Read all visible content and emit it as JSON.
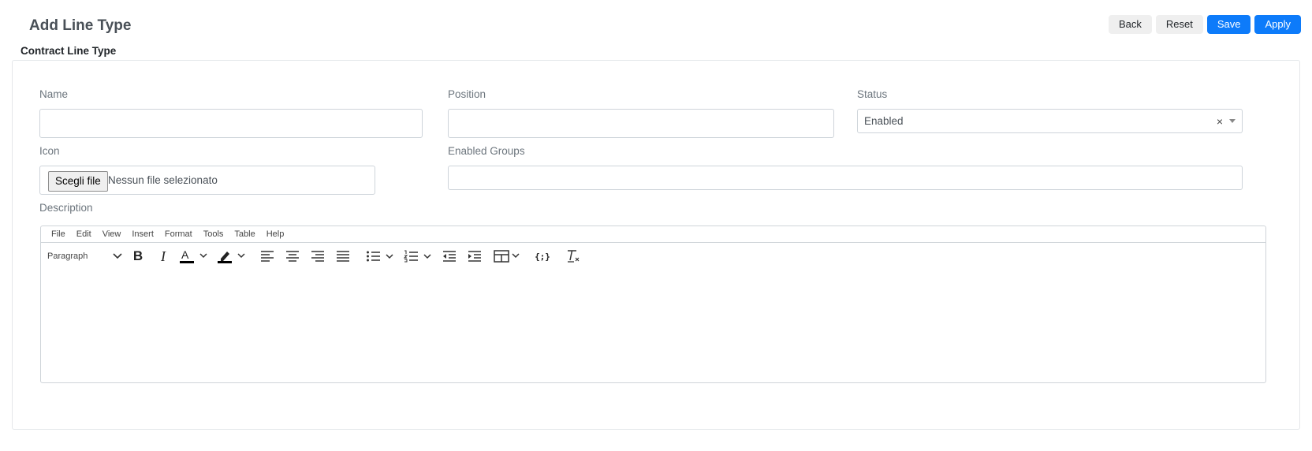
{
  "page": {
    "title": "Add Line Type"
  },
  "actions": {
    "back": "Back",
    "reset": "Reset",
    "save": "Save",
    "apply": "Apply"
  },
  "section": {
    "title": "Contract Line Type"
  },
  "form": {
    "name": {
      "label": "Name",
      "value": ""
    },
    "position": {
      "label": "Position",
      "value": ""
    },
    "status": {
      "label": "Status",
      "value": "Enabled",
      "clear": "×"
    },
    "icon": {
      "label": "Icon",
      "button": "Scegli file",
      "text": "Nessun file selezionato"
    },
    "enabled_groups": {
      "label": "Enabled Groups",
      "value": ""
    },
    "description": {
      "label": "Description"
    }
  },
  "editor": {
    "menu": [
      "File",
      "Edit",
      "View",
      "Insert",
      "Format",
      "Tools",
      "Table",
      "Help"
    ],
    "block_format": "Paragraph",
    "icons": [
      "chevron-down-icon",
      "bold-icon",
      "italic-icon",
      "text-color-icon",
      "highlight-icon",
      "align-left-icon",
      "align-center-icon",
      "align-right-icon",
      "align-justify-icon",
      "bullet-list-icon",
      "numbered-list-icon",
      "outdent-icon",
      "indent-icon",
      "table-icon",
      "code-variable-icon",
      "clear-formatting-icon"
    ]
  },
  "colors": {
    "primary": "#0d7bfa",
    "light_button": "#efefef",
    "border": "#ced4da"
  }
}
